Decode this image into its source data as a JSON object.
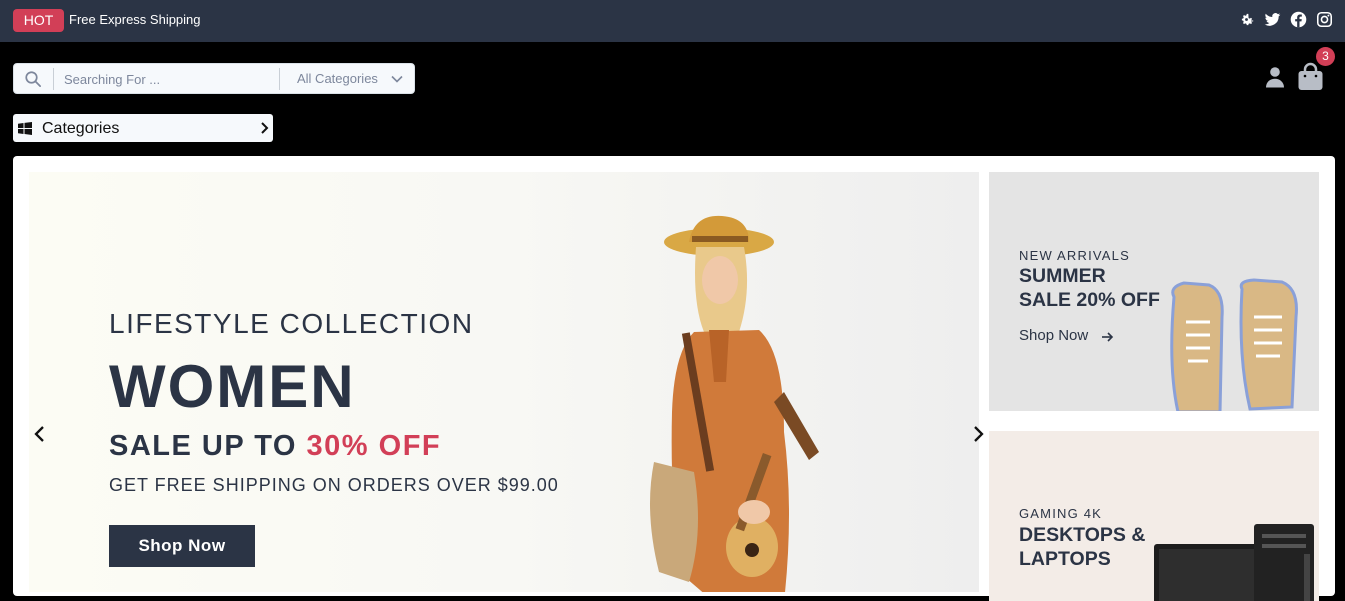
{
  "topbar": {
    "badge": "HOT",
    "shipping_text": "Free Express Shipping",
    "icons": [
      "settings-icon",
      "twitter-icon",
      "facebook-icon",
      "instagram-icon"
    ]
  },
  "search": {
    "placeholder": "Searching For ...",
    "category_select": "All Categories"
  },
  "cart": {
    "count": "3"
  },
  "categories_button": {
    "label": "Categories"
  },
  "hero": {
    "subtitle": "LIFESTYLE COLLECTION",
    "title": "WOMEN",
    "sale_prefix": "SALE UP TO ",
    "sale_highlight": "30% OFF",
    "shipping": "GET FREE SHIPPING ON ORDERS OVER $99.00",
    "button": "Shop Now"
  },
  "promos": [
    {
      "small": "NEW ARRIVALS",
      "title_line1": "SUMMER",
      "title_line2": "SALE 20% OFF",
      "link": "Shop Now"
    },
    {
      "small": "GAMING 4K",
      "title_line1": "DESKTOPS &",
      "title_line2": "LAPTOPS"
    }
  ],
  "colors": {
    "primary": "#2b3445",
    "accent": "#d23f57",
    "topbar": "#2b3445",
    "background": "#000000"
  }
}
